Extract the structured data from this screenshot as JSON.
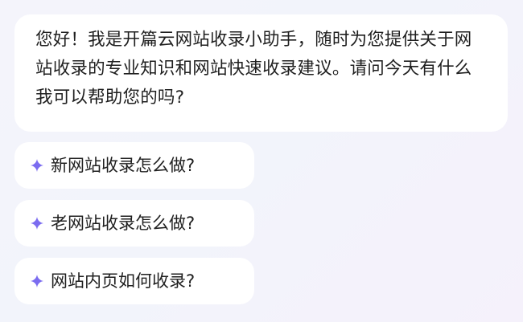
{
  "greeting": {
    "text": "您好！我是开篇云网站收录小助手，随时为您提供关于网站收录的专业知识和网站快速收录建议。请问今天有什么我可以帮助您的吗?"
  },
  "suggestions": [
    {
      "label": "新网站收录怎么做?",
      "icon": "sparkle-icon"
    },
    {
      "label": "老网站收录怎么做?",
      "icon": "sparkle-icon"
    },
    {
      "label": "网站内页如何收录?",
      "icon": "sparkle-icon"
    }
  ],
  "colors": {
    "accent": "#7b6cf0",
    "bubble_bg": "#ffffff",
    "text": "#1f1f1f"
  }
}
